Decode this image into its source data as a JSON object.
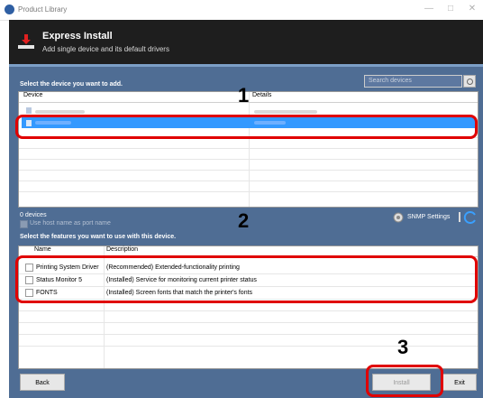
{
  "window": {
    "title": "Product Library",
    "minimize": "—",
    "maximize": "□",
    "close": "✕"
  },
  "header": {
    "title": "Express Install",
    "subtitle": "Add single device and its default drivers"
  },
  "search": {
    "placeholder": "Search devices"
  },
  "devices": {
    "section_label": "Select the device you want to add.",
    "columns": [
      "Device",
      "Details"
    ],
    "count": "0 devices",
    "host_name_option": "Use host name as port name",
    "snmp_label": "SNMP Settings"
  },
  "features": {
    "section_label": "Select the features you want to use with this device.",
    "columns": [
      "Name",
      "Description"
    ],
    "rows": [
      {
        "name": "Printing System Driver",
        "description": "(Recommended) Extended-functionality printing"
      },
      {
        "name": "Status Monitor 5",
        "description": "(Installed) Service for monitoring current printer status"
      },
      {
        "name": "FONTS",
        "description": "(Installed) Screen fonts that match the printer's fonts"
      }
    ]
  },
  "annotations": [
    "1",
    "2",
    "3"
  ],
  "buttons": {
    "back": "Back",
    "install": "Install",
    "exit": "Exit"
  },
  "colors": {
    "header_bg": "#1e1e1e",
    "body_bg": "#4f6d94",
    "selection": "#3399ff",
    "highlight": "#e00000"
  }
}
